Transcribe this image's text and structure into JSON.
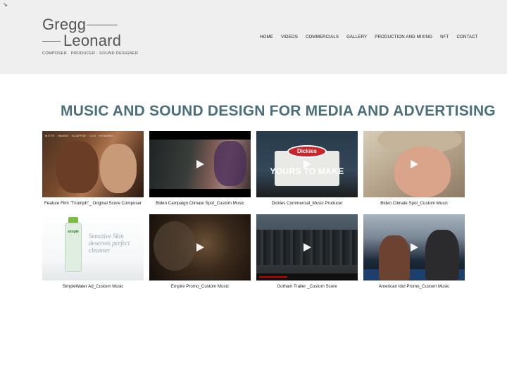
{
  "logo": {
    "line1": "Gregg",
    "line2": "Leonard",
    "tagline": "COMPOSER · PRODUCER · SOUND DESIGNER"
  },
  "nav": {
    "items": [
      "HOME",
      "VIDEOS",
      "COMMERCIALS",
      "GALLERY",
      "PRODUCTION AND MIXING",
      "NFT",
      "CONTACT"
    ]
  },
  "main": {
    "headline": "MUSIC AND SOUND DESIGN FOR MEDIA AND ADVERTISING"
  },
  "videos": [
    {
      "caption": "Feature Film \"Triumph\"_ Original Score Composer",
      "overlay": "MITTE · HANNE · SCAFFIDI · COX · HOWARD"
    },
    {
      "caption": "Biden Campaign Climate Spot_Custom Music"
    },
    {
      "caption": "Dickies Commercial_Music Producer",
      "overlay_brand": "Dickies",
      "overlay_text": "YOURS TO MAKE"
    },
    {
      "caption": "Biden Climate Spot_Custom Music"
    },
    {
      "caption": "SimpleWater Ad_Custom Music",
      "overlay_brand": "simple",
      "overlay_text": "Sensitive Skin deserves perfect cleanser"
    },
    {
      "caption": "Empire Promo_Custom Music"
    },
    {
      "caption": "Gotham Trailer _Custom Score"
    },
    {
      "caption": "American Idol Promo_Custom Music"
    }
  ],
  "colors": {
    "header_bg": "#efefef",
    "headline": "#4b6f7b",
    "play_icon": "#ffffff"
  }
}
